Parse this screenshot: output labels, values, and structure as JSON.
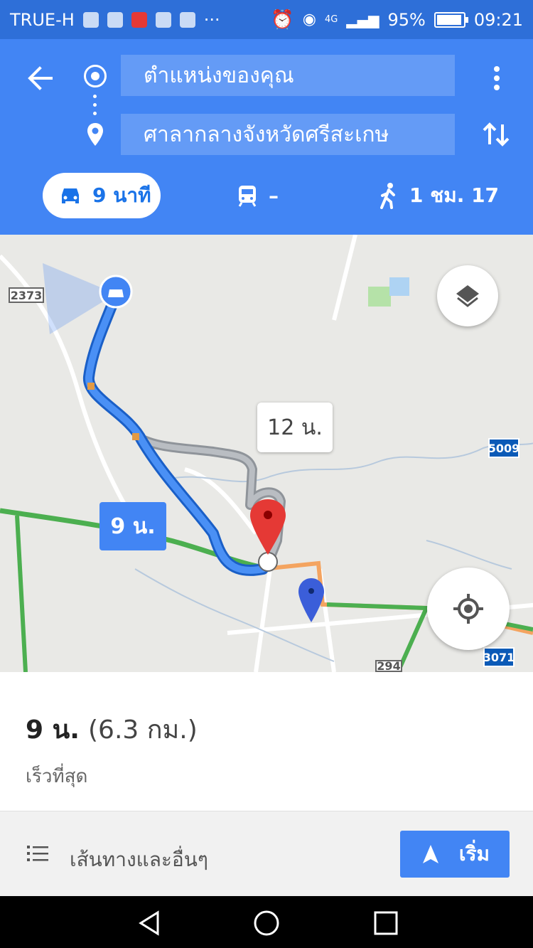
{
  "status_bar": {
    "carrier": "TRUE-H",
    "more": "···",
    "network": "4G",
    "battery_percent": "95%",
    "battery_level": 0.95,
    "time": "09:21"
  },
  "header": {
    "origin": "ตำแหน่งของคุณ",
    "destination": "ศาลากลางจังหวัดศรีสะเกษ"
  },
  "modes": {
    "drive": "9 นาที",
    "transit": "–",
    "walk": "1 ชม. 17"
  },
  "map": {
    "alt_route_label": "12 น.",
    "main_route_label": "9 น.",
    "road_2373": "2373",
    "road_5009": "5009",
    "road_3071": "3071",
    "road_294": "294"
  },
  "summary": {
    "time": "9 น.",
    "distance": "(6.3 กม.)",
    "note": "เร็วที่สุด"
  },
  "actions": {
    "routes": "เส้นทางและอื่นๆ",
    "start": "เริ่ม"
  },
  "colors": {
    "header_blue": "#4285f4",
    "route_blue": "#4285f4",
    "alt_route_gray": "#a9aeb3",
    "pin_red": "#e53935",
    "traffic_green": "#4caf50",
    "traffic_orange": "#f4a460"
  }
}
